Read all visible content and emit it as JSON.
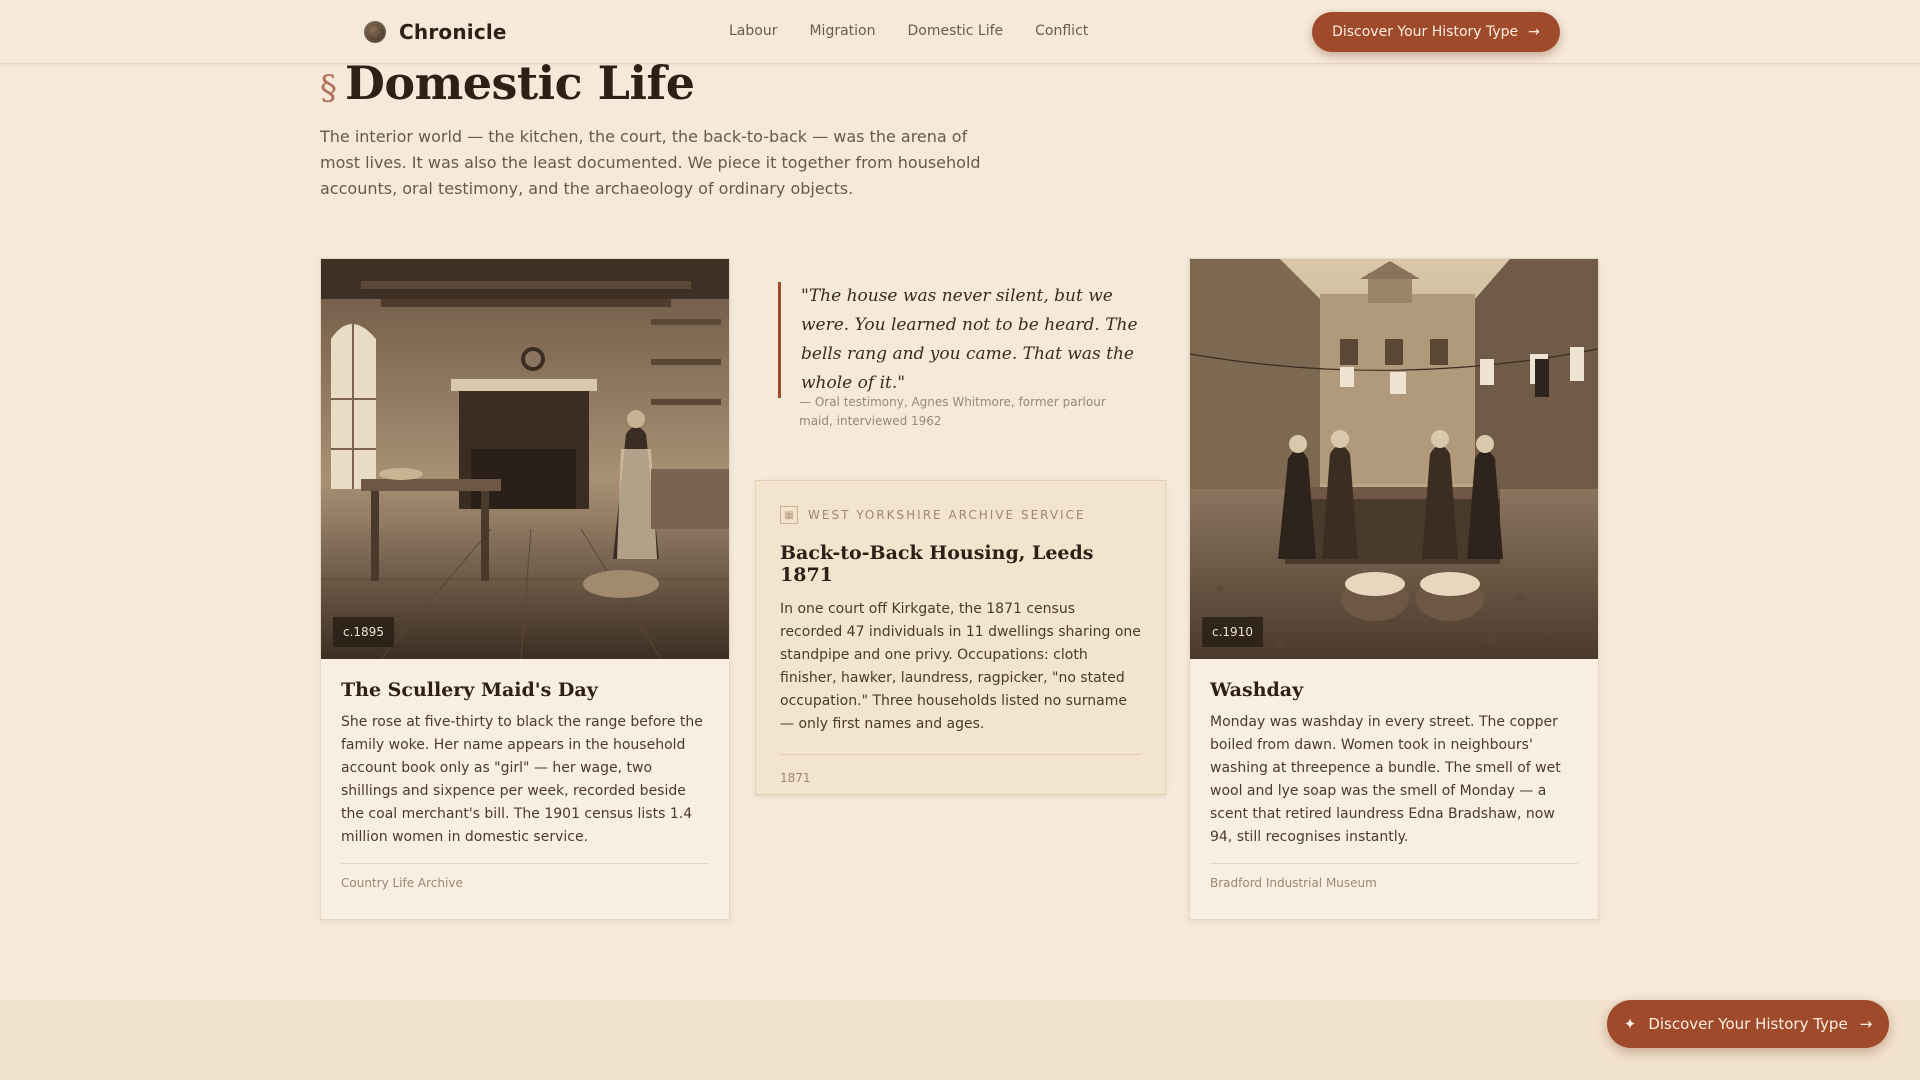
{
  "nav": {
    "brand": "Chronicle",
    "links": [
      "Labour",
      "Migration",
      "Domestic Life",
      "Conflict"
    ],
    "cta_label": "Discover Your History Type"
  },
  "section": {
    "mark": "§",
    "title": "Domestic Life",
    "intro": "The interior world — the kitchen, the court, the back-to-back — was the arena of most lives. It was also the least documented. We piece it together from household accounts, oral testimony, and the archaeology of ordinary objects."
  },
  "cards": [
    {
      "date": "c.1895",
      "title": "The Scullery Maid's Day",
      "text": "She rose at five-thirty to black the range before the family woke. Her name appears in the household account book only as \"girl\" — her wage, two shillings and sixpence per week, recorded beside the coal merchant's bill. The 1901 census lists 1.4 million women in domestic service.",
      "source": "Country Life Archive"
    },
    {
      "date": "c.1910",
      "title": "Washday",
      "text": "Monday was washday in every street. The copper boiled from dawn. Women took in neighbours' washing at threepence a bundle. The smell of wet wool and lye soap was the smell of Monday — a scent that retired laundress Edna Bradshaw, now 94, still recognises instantly.",
      "source": "Bradford Industrial Museum"
    }
  ],
  "quote": {
    "text": "\"The house was never silent, but we were. You learned not to be heard. The bells rang and you came. That was the whole of it.\"",
    "cite": "— Oral testimony, Agnes Whitmore, former parlour maid, interviewed 1962"
  },
  "archive": {
    "label": "WEST YORKSHIRE ARCHIVE SERVICE",
    "title": "Back-to-Back Housing, Leeds 1871",
    "text": "In one court off Kirkgate, the 1871 census recorded 47 individuals in 11 dwellings sharing one standpipe and one privy. Occupations: cloth finisher, hawker, laundress, ragpicker, \"no stated occupation.\" Three households listed no surname — only first names and ages.",
    "year": "1871"
  },
  "floating_cta": {
    "label": "Discover Your History Type",
    "icon": "sparkle-icon"
  },
  "colors": {
    "accent": "#a04a2c",
    "background": "#f5eada"
  }
}
